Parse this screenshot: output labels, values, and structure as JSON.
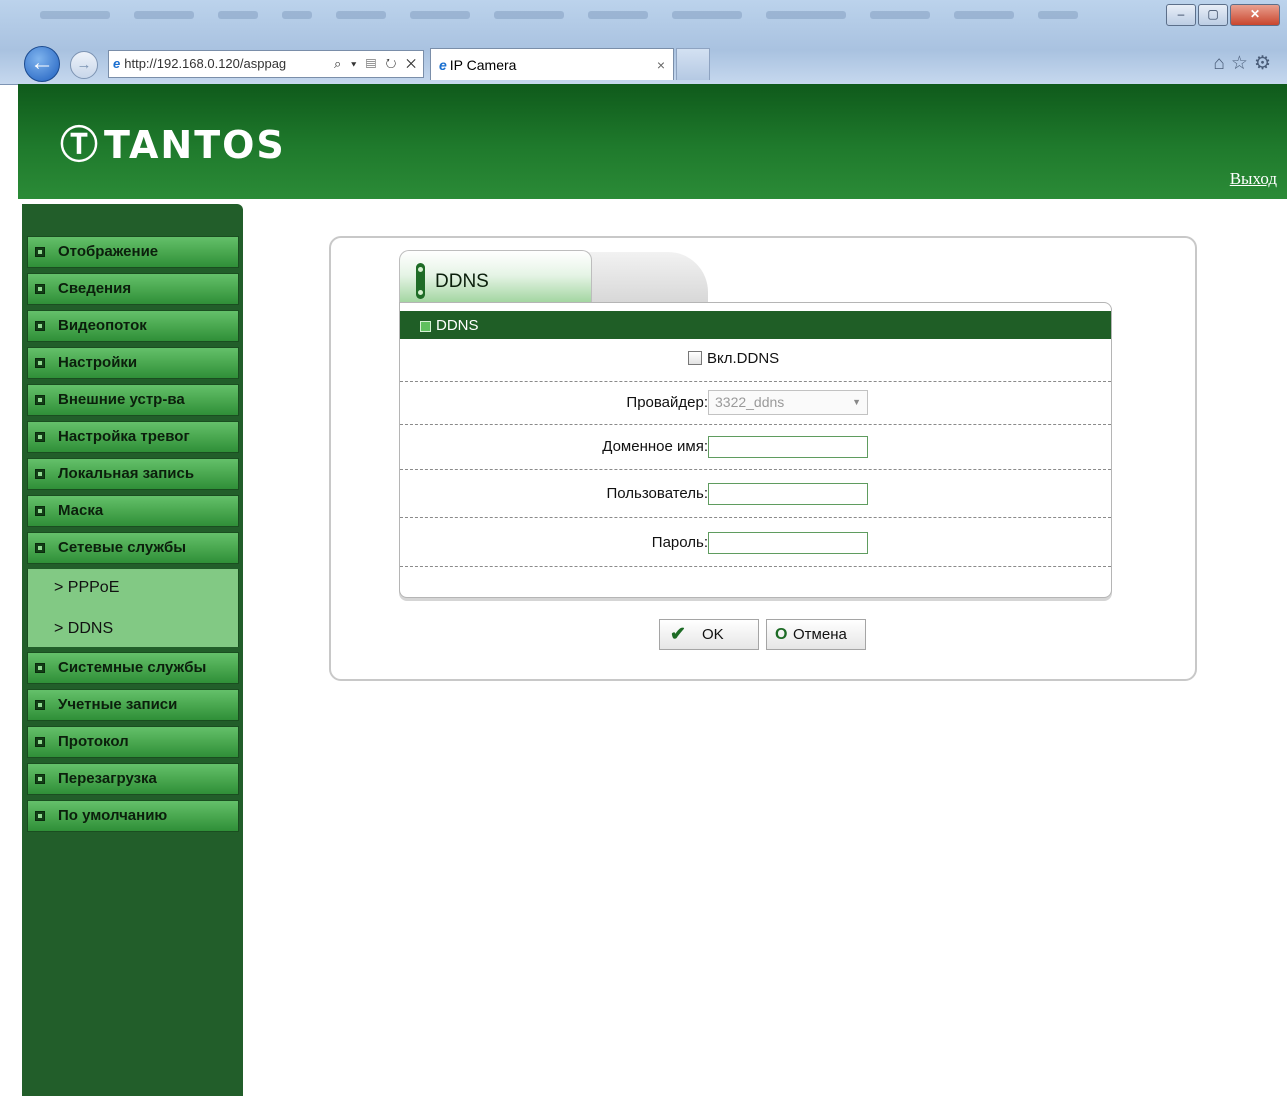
{
  "browser": {
    "address_url": "http://192.168.0.120/asppag",
    "address_tools": "⌕ ▾ ▤ ↻ ✕",
    "tab_title": "IP Camera",
    "tab_close": "×",
    "window_buttons": {
      "minimize": "–",
      "maximize": "▢",
      "close": "✕"
    },
    "toolbar_icons": {
      "home": "⌂",
      "favorites": "☆",
      "tools": "⚙"
    }
  },
  "header": {
    "logo_text": "TANTOS",
    "logo_icon": "Ⓣ",
    "logout": "Выход",
    "color": "#1f7a2c"
  },
  "sidebar": {
    "items": [
      {
        "label": "Отображение"
      },
      {
        "label": "Сведения"
      },
      {
        "label": "Видеопоток"
      },
      {
        "label": "Настройки"
      },
      {
        "label": "Внешние устр-ва"
      },
      {
        "label": "Настройка тревог"
      },
      {
        "label": "Локальная запись"
      },
      {
        "label": "Маска"
      },
      {
        "label": "Сетевые службы"
      },
      {
        "label": "Системные службы"
      },
      {
        "label": "Учетные записи"
      },
      {
        "label": "Протокол"
      },
      {
        "label": "Перезагрузка"
      },
      {
        "label": "По умолчанию"
      }
    ],
    "submenu": [
      {
        "label": "> PPPoE"
      },
      {
        "label": "> DDNS"
      }
    ]
  },
  "main": {
    "tab_label": "DDNS",
    "section_title": "DDNS",
    "enable_label": "Вкл.DDNS",
    "enable_checked": false,
    "provider_label": "Провайдер:",
    "provider_value": "3322_ddns",
    "domain_label": "Доменное имя:",
    "domain_value": "",
    "user_label": "Пользователь:",
    "user_value": "",
    "password_label": "Пароль:",
    "password_value": ""
  },
  "buttons": {
    "ok_icon": "✔",
    "ok_label": "OK",
    "cancel_icon": "O",
    "cancel_label": "Отмена"
  }
}
